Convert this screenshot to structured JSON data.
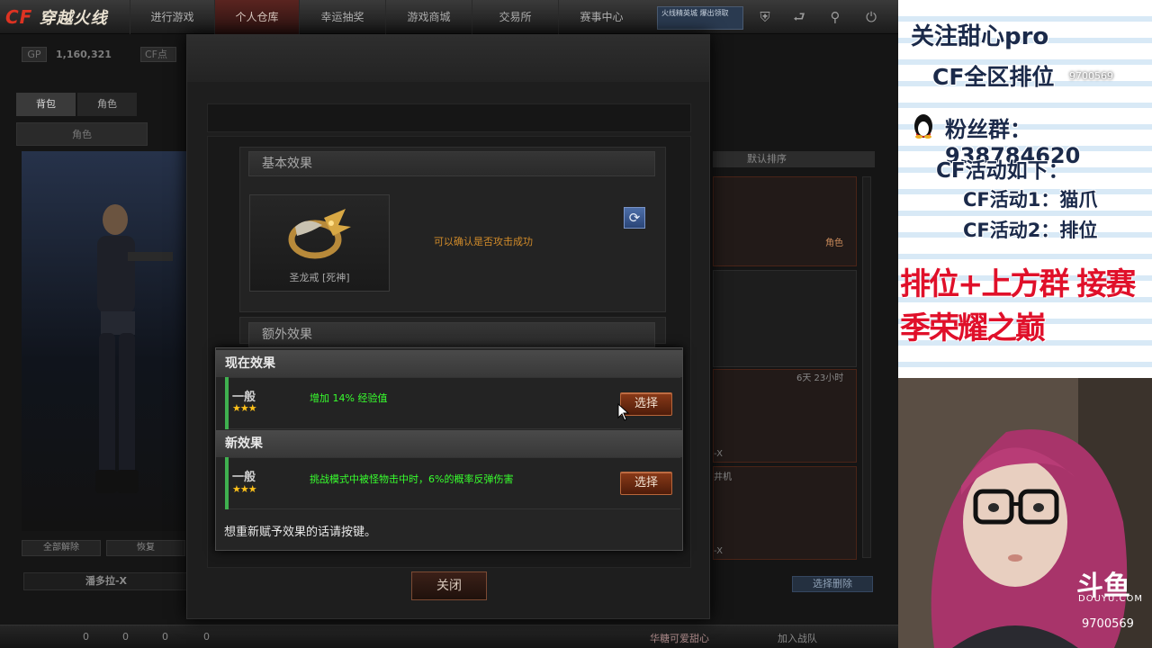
{
  "app": {
    "logo_cf": "CF",
    "logo_text": "穿越火线"
  },
  "nav": {
    "tabs": [
      "进行游戏",
      "个人仓库",
      "幸运抽奖",
      "游戏商城",
      "交易所",
      "赛事中心"
    ],
    "active_index": 1,
    "promo_text": "火线精英城 爆出领取"
  },
  "currency": {
    "gp_label": "GP",
    "gp_value": "1,160,321",
    "cf_label": "CF点"
  },
  "left": {
    "tabs": [
      "背包",
      "角色"
    ],
    "role_label": "角色",
    "buttons": [
      "全部解除",
      "恢复"
    ],
    "character_name": "潘多拉-X"
  },
  "right": {
    "sort_label": "默认排序",
    "slots": [
      {
        "tag": "角色"
      },
      {
        "tag": ""
      },
      {
        "time": "6天 23小时",
        "name": "-X"
      },
      {
        "name": "-X",
        "top": "井机"
      }
    ],
    "select_remove": "选择删除"
  },
  "bottom": {
    "counts": [
      "0",
      "0",
      "0",
      "0"
    ],
    "notice": "华糖可爱甜心",
    "join_team": "加入战队"
  },
  "dialog": {
    "basic_title": "基本效果",
    "item_name": "圣龙戒 [死神]",
    "confirm_text": "可以确认是否攻击成功",
    "extra_title": "额外效果",
    "close_label": "关闭"
  },
  "popup": {
    "current": {
      "title": "现在效果",
      "grade": "一般",
      "stars": "★★★",
      "effect": "增加 14% 经验值",
      "button": "选择"
    },
    "new": {
      "title": "新效果",
      "grade": "一般",
      "stars": "★★★",
      "effect": "挑战模式中被怪物击中时，6%的概率反弹伤害",
      "button": "选择"
    },
    "hint": "想重新赋予效果的话请按键。"
  },
  "stream": {
    "line1": "关注甜心pro",
    "line2": "CF全区排位",
    "line3": "粉丝群：938784620",
    "line4": "CF活动如下：",
    "line5": "CF活动1：猫爪",
    "line6": "CF活动2：排位",
    "line7": "排位+上方群 接赛季荣耀之巅",
    "room_id_top": "9700569",
    "douyu_logo": "斗鱼",
    "douyu_com": "DOUYU.COM",
    "room_id": "9700569"
  },
  "colors": {
    "accent_orange": "#d18b2a",
    "effect_green": "#38ff2e",
    "grade_bar": "#3fb04f",
    "star_yellow": "#ffc21a",
    "red_text": "#e0102a"
  }
}
